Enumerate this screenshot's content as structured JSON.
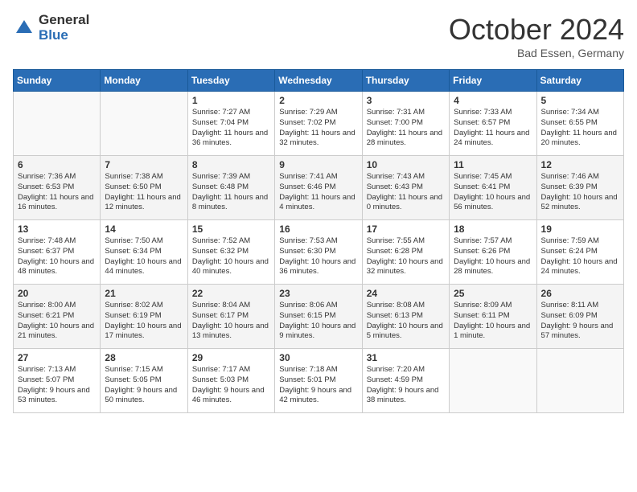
{
  "logo": {
    "general": "General",
    "blue": "Blue"
  },
  "title": "October 2024",
  "location": "Bad Essen, Germany",
  "days_of_week": [
    "Sunday",
    "Monday",
    "Tuesday",
    "Wednesday",
    "Thursday",
    "Friday",
    "Saturday"
  ],
  "weeks": [
    [
      {
        "day": "",
        "info": ""
      },
      {
        "day": "",
        "info": ""
      },
      {
        "day": "1",
        "info": "Sunrise: 7:27 AM\nSunset: 7:04 PM\nDaylight: 11 hours and 36 minutes."
      },
      {
        "day": "2",
        "info": "Sunrise: 7:29 AM\nSunset: 7:02 PM\nDaylight: 11 hours and 32 minutes."
      },
      {
        "day": "3",
        "info": "Sunrise: 7:31 AM\nSunset: 7:00 PM\nDaylight: 11 hours and 28 minutes."
      },
      {
        "day": "4",
        "info": "Sunrise: 7:33 AM\nSunset: 6:57 PM\nDaylight: 11 hours and 24 minutes."
      },
      {
        "day": "5",
        "info": "Sunrise: 7:34 AM\nSunset: 6:55 PM\nDaylight: 11 hours and 20 minutes."
      }
    ],
    [
      {
        "day": "6",
        "info": "Sunrise: 7:36 AM\nSunset: 6:53 PM\nDaylight: 11 hours and 16 minutes."
      },
      {
        "day": "7",
        "info": "Sunrise: 7:38 AM\nSunset: 6:50 PM\nDaylight: 11 hours and 12 minutes."
      },
      {
        "day": "8",
        "info": "Sunrise: 7:39 AM\nSunset: 6:48 PM\nDaylight: 11 hours and 8 minutes."
      },
      {
        "day": "9",
        "info": "Sunrise: 7:41 AM\nSunset: 6:46 PM\nDaylight: 11 hours and 4 minutes."
      },
      {
        "day": "10",
        "info": "Sunrise: 7:43 AM\nSunset: 6:43 PM\nDaylight: 11 hours and 0 minutes."
      },
      {
        "day": "11",
        "info": "Sunrise: 7:45 AM\nSunset: 6:41 PM\nDaylight: 10 hours and 56 minutes."
      },
      {
        "day": "12",
        "info": "Sunrise: 7:46 AM\nSunset: 6:39 PM\nDaylight: 10 hours and 52 minutes."
      }
    ],
    [
      {
        "day": "13",
        "info": "Sunrise: 7:48 AM\nSunset: 6:37 PM\nDaylight: 10 hours and 48 minutes."
      },
      {
        "day": "14",
        "info": "Sunrise: 7:50 AM\nSunset: 6:34 PM\nDaylight: 10 hours and 44 minutes."
      },
      {
        "day": "15",
        "info": "Sunrise: 7:52 AM\nSunset: 6:32 PM\nDaylight: 10 hours and 40 minutes."
      },
      {
        "day": "16",
        "info": "Sunrise: 7:53 AM\nSunset: 6:30 PM\nDaylight: 10 hours and 36 minutes."
      },
      {
        "day": "17",
        "info": "Sunrise: 7:55 AM\nSunset: 6:28 PM\nDaylight: 10 hours and 32 minutes."
      },
      {
        "day": "18",
        "info": "Sunrise: 7:57 AM\nSunset: 6:26 PM\nDaylight: 10 hours and 28 minutes."
      },
      {
        "day": "19",
        "info": "Sunrise: 7:59 AM\nSunset: 6:24 PM\nDaylight: 10 hours and 24 minutes."
      }
    ],
    [
      {
        "day": "20",
        "info": "Sunrise: 8:00 AM\nSunset: 6:21 PM\nDaylight: 10 hours and 21 minutes."
      },
      {
        "day": "21",
        "info": "Sunrise: 8:02 AM\nSunset: 6:19 PM\nDaylight: 10 hours and 17 minutes."
      },
      {
        "day": "22",
        "info": "Sunrise: 8:04 AM\nSunset: 6:17 PM\nDaylight: 10 hours and 13 minutes."
      },
      {
        "day": "23",
        "info": "Sunrise: 8:06 AM\nSunset: 6:15 PM\nDaylight: 10 hours and 9 minutes."
      },
      {
        "day": "24",
        "info": "Sunrise: 8:08 AM\nSunset: 6:13 PM\nDaylight: 10 hours and 5 minutes."
      },
      {
        "day": "25",
        "info": "Sunrise: 8:09 AM\nSunset: 6:11 PM\nDaylight: 10 hours and 1 minute."
      },
      {
        "day": "26",
        "info": "Sunrise: 8:11 AM\nSunset: 6:09 PM\nDaylight: 9 hours and 57 minutes."
      }
    ],
    [
      {
        "day": "27",
        "info": "Sunrise: 7:13 AM\nSunset: 5:07 PM\nDaylight: 9 hours and 53 minutes."
      },
      {
        "day": "28",
        "info": "Sunrise: 7:15 AM\nSunset: 5:05 PM\nDaylight: 9 hours and 50 minutes."
      },
      {
        "day": "29",
        "info": "Sunrise: 7:17 AM\nSunset: 5:03 PM\nDaylight: 9 hours and 46 minutes."
      },
      {
        "day": "30",
        "info": "Sunrise: 7:18 AM\nSunset: 5:01 PM\nDaylight: 9 hours and 42 minutes."
      },
      {
        "day": "31",
        "info": "Sunrise: 7:20 AM\nSunset: 4:59 PM\nDaylight: 9 hours and 38 minutes."
      },
      {
        "day": "",
        "info": ""
      },
      {
        "day": "",
        "info": ""
      }
    ]
  ]
}
